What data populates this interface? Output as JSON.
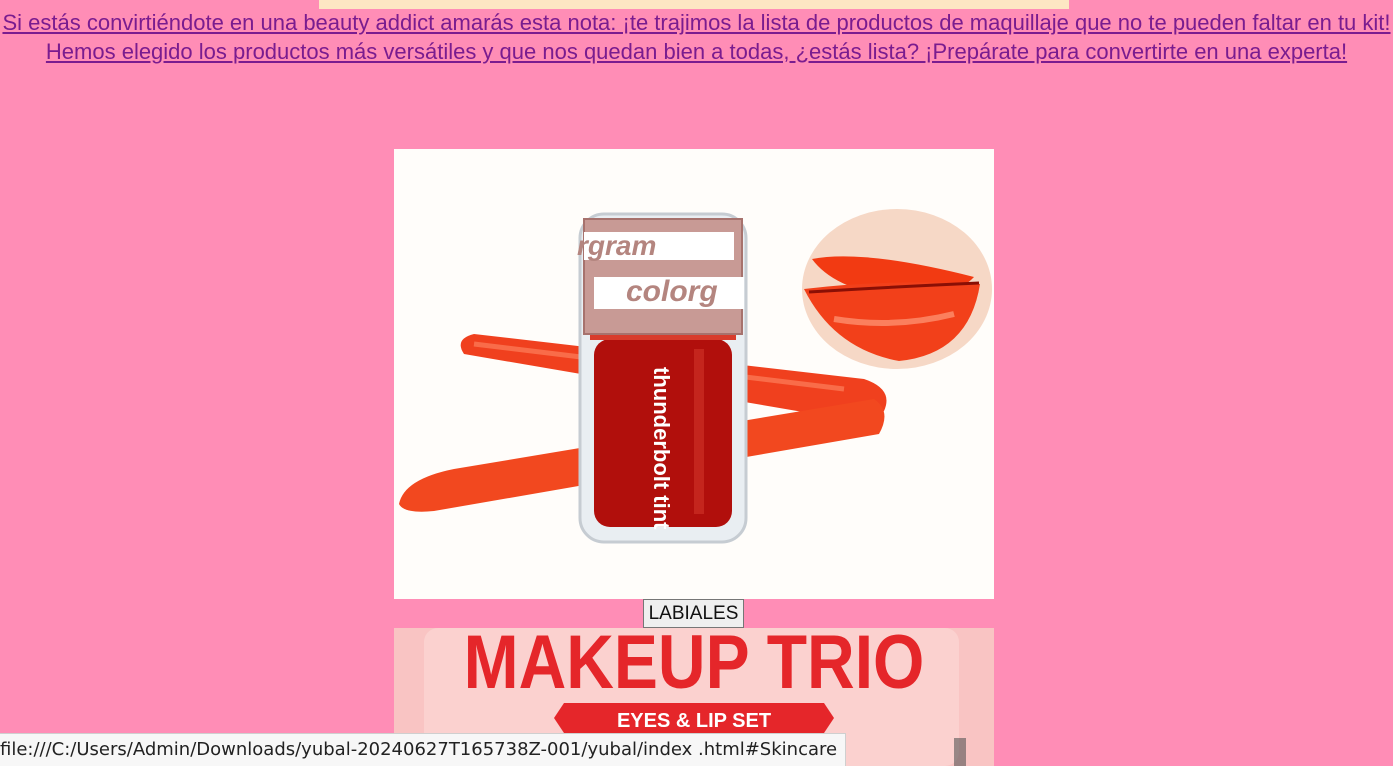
{
  "intro": {
    "text": "Si estás convirtiéndote en una beauty addict amarás esta nota: ¡te trajimos la lista de productos de maquillaje que no te pueden faltar en tu kit! Hemos elegido los productos más versátiles y que nos quedan bien a todas, ¿estás lista? ¡Prepárate para convertirte en una experta!"
  },
  "product1": {
    "brand_top": "rgram",
    "brand_mid": "colorg",
    "bottle_label": "thunderbolt tint",
    "button_label": "LABIALES"
  },
  "product2": {
    "title": "MAKEUP TRIO",
    "subtitle": "EYES & LIP SET"
  },
  "statusbar": {
    "url": "file:///C:/Users/Admin/Downloads/yubal-20240627T165738Z-001/yubal/index .html#Skincare"
  },
  "colors": {
    "page_bg": "#ff8db6",
    "link": "#7a1c8f",
    "strip": "#fde6c3"
  }
}
